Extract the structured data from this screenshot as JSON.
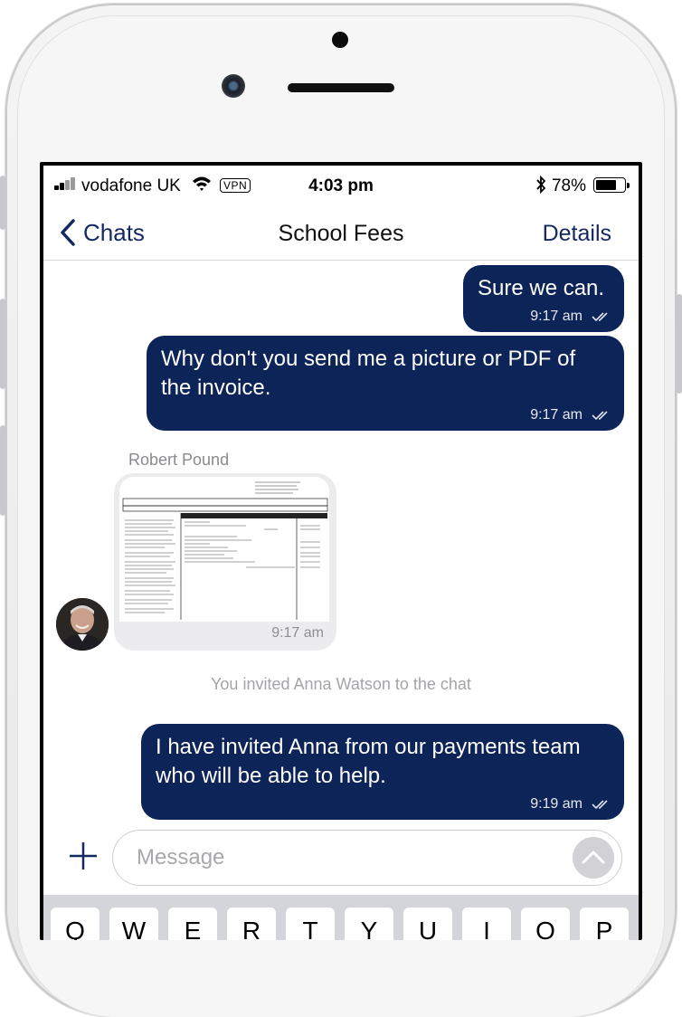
{
  "status_bar": {
    "carrier": "vodafone UK",
    "vpn_label": "VPN",
    "time": "4:03 pm",
    "battery_percent": "78%",
    "battery_level": 0.78
  },
  "nav": {
    "back_label": "Chats",
    "title": "School Fees",
    "details_label": "Details"
  },
  "messages": [
    {
      "text": "Sure we can.",
      "time": "9:17 am"
    },
    {
      "text": "Why don't you send me a picture or PDF of the invoice.",
      "time": "9:17 am"
    },
    {
      "sender": "Robert Pound",
      "time": "9:17 am"
    },
    {
      "system": "You invited Anna Watson to the chat"
    },
    {
      "text": "I have invited Anna from our payments team who will be able to help.",
      "time": "9:19 am"
    }
  ],
  "input": {
    "placeholder": "Message"
  },
  "keyboard": {
    "keys": [
      "Q",
      "W",
      "E",
      "R",
      "T",
      "Y",
      "U",
      "I",
      "O",
      "P"
    ]
  },
  "colors": {
    "bubble_outgoing": "#0d2458",
    "nav_accent": "#13295f"
  },
  "icons": [
    "back-chevron-icon",
    "wifi-icon",
    "bluetooth-icon",
    "battery-icon",
    "double-check-icon",
    "plus-icon",
    "send-arrow-icon"
  ]
}
